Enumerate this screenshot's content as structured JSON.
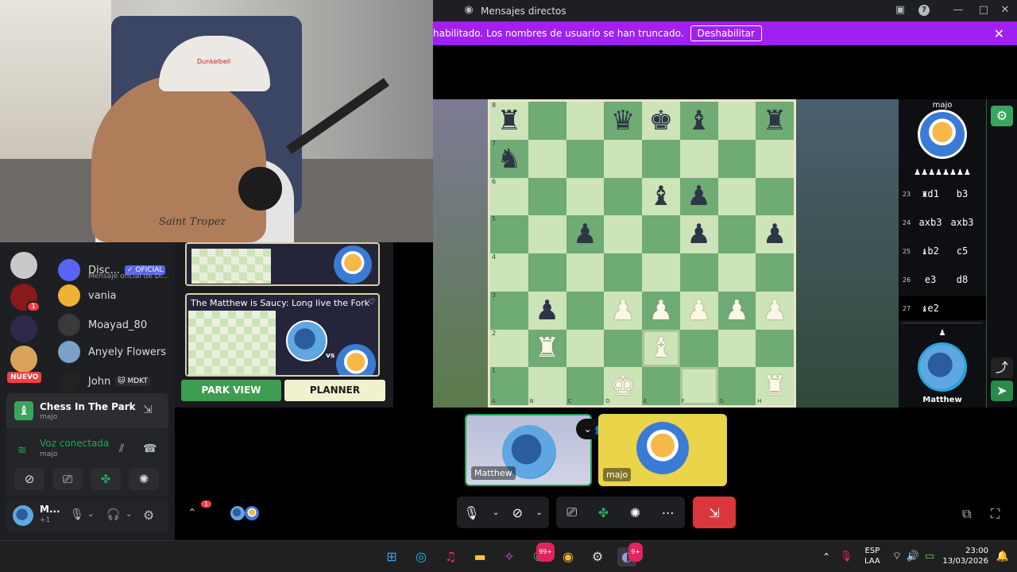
{
  "window": {
    "title": "Mensajes directos",
    "minimize": "—",
    "maximize": "□",
    "close": "✕"
  },
  "banner": {
    "text": "habilitado. Los nombres de usuario se han truncado.",
    "button": "Deshabilitar",
    "close": "✕"
  },
  "webcam": {
    "cap_text": "Dunkelbell",
    "shirt_text": "Saint Tropez"
  },
  "board": {
    "ranks": [
      "8",
      "7",
      "6",
      "5",
      "4",
      "3",
      "2",
      "1"
    ],
    "files": [
      "A",
      "B",
      "C",
      "D",
      "E",
      "F",
      "G",
      "H"
    ],
    "rows": [
      [
        "br",
        "",
        "",
        "bq",
        "bk",
        "bb",
        "",
        "br"
      ],
      [
        "bn",
        "",
        "",
        "",
        "",
        "",
        "",
        ""
      ],
      [
        "",
        "",
        "",
        "",
        "bb",
        "bp",
        "",
        ""
      ],
      [
        "",
        "",
        "bp",
        "",
        "",
        "bp",
        "",
        "bp"
      ],
      [
        "",
        "",
        "",
        "",
        "",
        "",
        "",
        ""
      ],
      [
        "",
        "bp",
        "",
        "wp",
        "wp",
        "wp",
        "wp",
        "wp"
      ],
      [
        "",
        "wr",
        "",
        "",
        "wb",
        "",
        "",
        ""
      ],
      [
        "",
        "",
        "",
        "wk",
        "",
        "",
        "",
        "wr"
      ]
    ],
    "highlight": [
      [
        6,
        4
      ],
      [
        7,
        5
      ]
    ]
  },
  "players": {
    "top_name": "majo",
    "top_captured": "♟♟♟♟♟♟♟♟",
    "bottom_name": "Matthew",
    "bottom_captured": "♟"
  },
  "moves": [
    {
      "n": "23",
      "w": "♜d1",
      "b": "b3"
    },
    {
      "n": "24",
      "w": "axb3",
      "b": "axb3"
    },
    {
      "n": "25",
      "w": "♝b2",
      "b": "c5"
    },
    {
      "n": "26",
      "w": "e3",
      "b": "d8"
    },
    {
      "n": "27",
      "w": "♝e2",
      "b": ""
    }
  ],
  "dms": [
    {
      "name": "Disc...",
      "badge": "✓ OFICIAL",
      "sub": "Mensaje oficial de Di...",
      "color": "#5865f2"
    },
    {
      "name": "vania",
      "color": "#f0b232"
    },
    {
      "name": "Moayad_80",
      "color": "#3a3a3a"
    },
    {
      "name": "Anyely Flowers",
      "color": "#7aa0c8"
    },
    {
      "name": "John",
      "badge": "🐱 MDKT",
      "color": "#222"
    }
  ],
  "server_badge": "1",
  "nuevo": "NUEVO",
  "activity": {
    "title": "Chess In The Park",
    "sub": "majo"
  },
  "voice": {
    "status": "Voz conectada",
    "sub": "majo"
  },
  "user": {
    "name": "M...",
    "sub": "+1"
  },
  "planner": {
    "card_title": "The Matthew is Saucy: Long live the Fork",
    "vs": "vs",
    "tab_park": "PARK VIEW",
    "tab_planner": "PLANNER"
  },
  "call": {
    "tile1": "Matthew",
    "tile2": "majo",
    "notif": "1"
  },
  "taskbar": {
    "whatsapp_badge": "99+",
    "discord_badge": "9+",
    "lang_top": "ESP",
    "lang_bottom": "LAA",
    "time": "23:00",
    "date": "13/03/2026"
  }
}
